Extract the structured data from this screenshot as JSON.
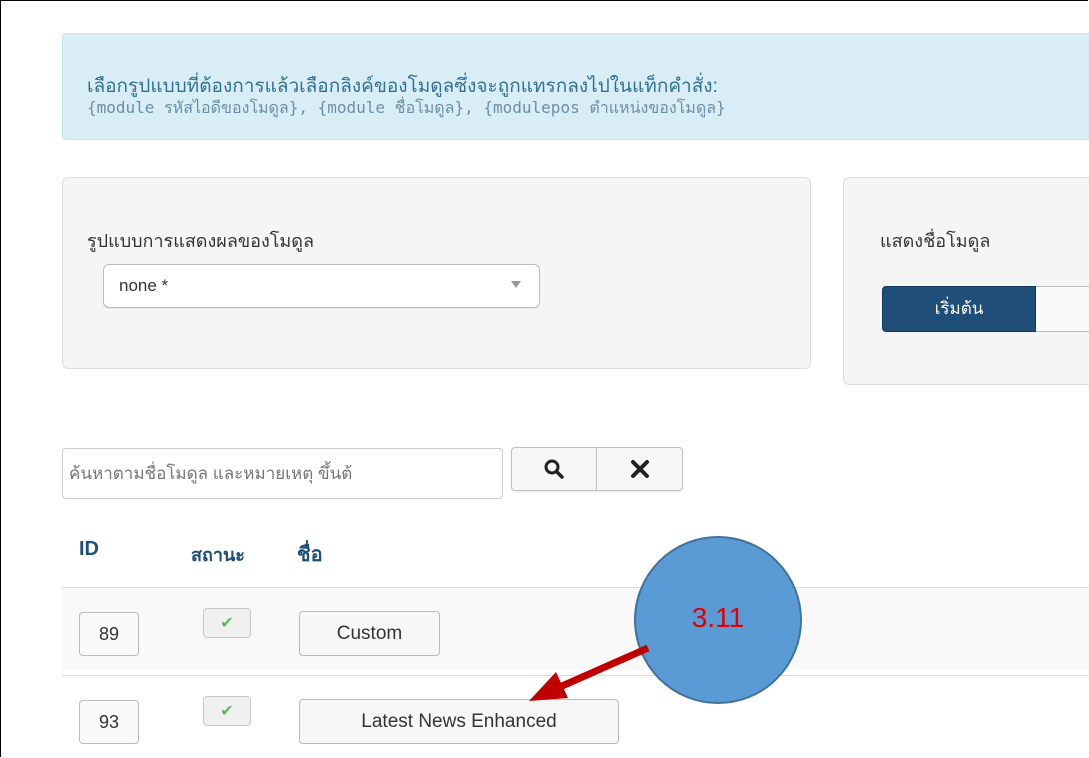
{
  "info": {
    "line1": "เลือกรูปแบบที่ต้องการแล้วเลือกลิงค์ของโมดูลซึ่งจะถูกแทรกลงไปในแท็กคำสั่ง:",
    "line2": "{module รหัสไอดีของโมดูล}, {module ชื่อโมดูล}, {modulepos ตำแหน่งของโมดูล}"
  },
  "style_panel": {
    "label": "รูปแบบการแสดงผลของโมดูล",
    "selected": "none *"
  },
  "show_title_panel": {
    "label": "แสดงชื่อโมดูล",
    "active_option": "เริ่มต้น"
  },
  "search": {
    "placeholder": "ค้นหาตามชื่อโมดูล และหมายเหตุ ขึ้นต้"
  },
  "table": {
    "headers": {
      "id": "ID",
      "status": "สถานะ",
      "name": "ชื่อ"
    },
    "rows": [
      {
        "id": "89",
        "status": "published",
        "name": "Custom"
      },
      {
        "id": "93",
        "status": "published",
        "name": "Latest News Enhanced"
      }
    ]
  },
  "annotation": {
    "label": "3.11",
    "color": "#5b9bd5",
    "arrow_color": "#c00000"
  },
  "icons": {
    "search": "search-icon",
    "clear": "close-icon",
    "status": "check-icon",
    "dropdown": "caret-down-icon"
  }
}
